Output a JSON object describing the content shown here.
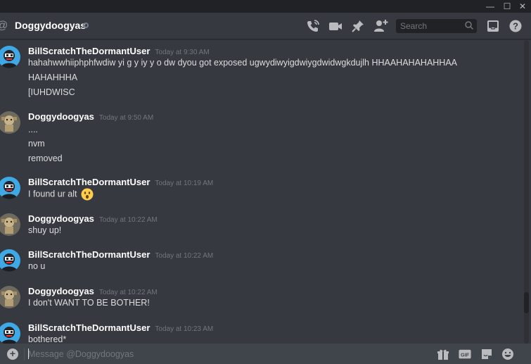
{
  "window": {
    "minimize": "—",
    "maximize": "☐",
    "close": "✕"
  },
  "header": {
    "at_symbol": "@",
    "channel_name": "Doggydoogyas",
    "search_placeholder": "Search"
  },
  "messages": [
    {
      "author": "BillScratchTheDormantUser",
      "time": "Today at 9:30 AM",
      "avatar": "bill",
      "lines": [
        "hahahwwhiiphphfwdiw yi g  y iy y o  dw dyou got exposed ugwydiwyigdwiygdwidwgkdujlh HHAAHAHAHAHHAA",
        "HAHAHHHA",
        "[IUHDWISC"
      ]
    },
    {
      "author": "Doggydoogyas",
      "time": "Today at 9:50 AM",
      "avatar": "doggy",
      "lines": [
        "....",
        "nvm",
        "removed"
      ]
    },
    {
      "author": "BillScratchTheDormantUser",
      "time": "Today at 10:19 AM",
      "avatar": "bill",
      "lines": [
        "I found ur alt"
      ],
      "emoji": "astonished-face"
    },
    {
      "author": "Doggydoogyas",
      "time": "Today at 10:22 AM",
      "avatar": "doggy",
      "lines": [
        "shuy up!"
      ]
    },
    {
      "author": "BillScratchTheDormantUser",
      "time": "Today at 10:22 AM",
      "avatar": "bill",
      "lines": [
        "no u"
      ]
    },
    {
      "author": "Doggydoogyas",
      "time": "Today at 10:22 AM",
      "avatar": "doggy",
      "lines": [
        "I don't WANT TO BE BOTHER!"
      ]
    },
    {
      "author": "BillScratchTheDormantUser",
      "time": "Today at 10:23 AM",
      "avatar": "bill",
      "lines": [
        "bothered*"
      ]
    }
  ],
  "composer": {
    "placeholder": "Message @Doggydoogyas"
  },
  "colors": {
    "background": "#36393f",
    "titlebar": "#202225",
    "composer": "#40444b",
    "accent_avatar": "#3fa9e6"
  }
}
